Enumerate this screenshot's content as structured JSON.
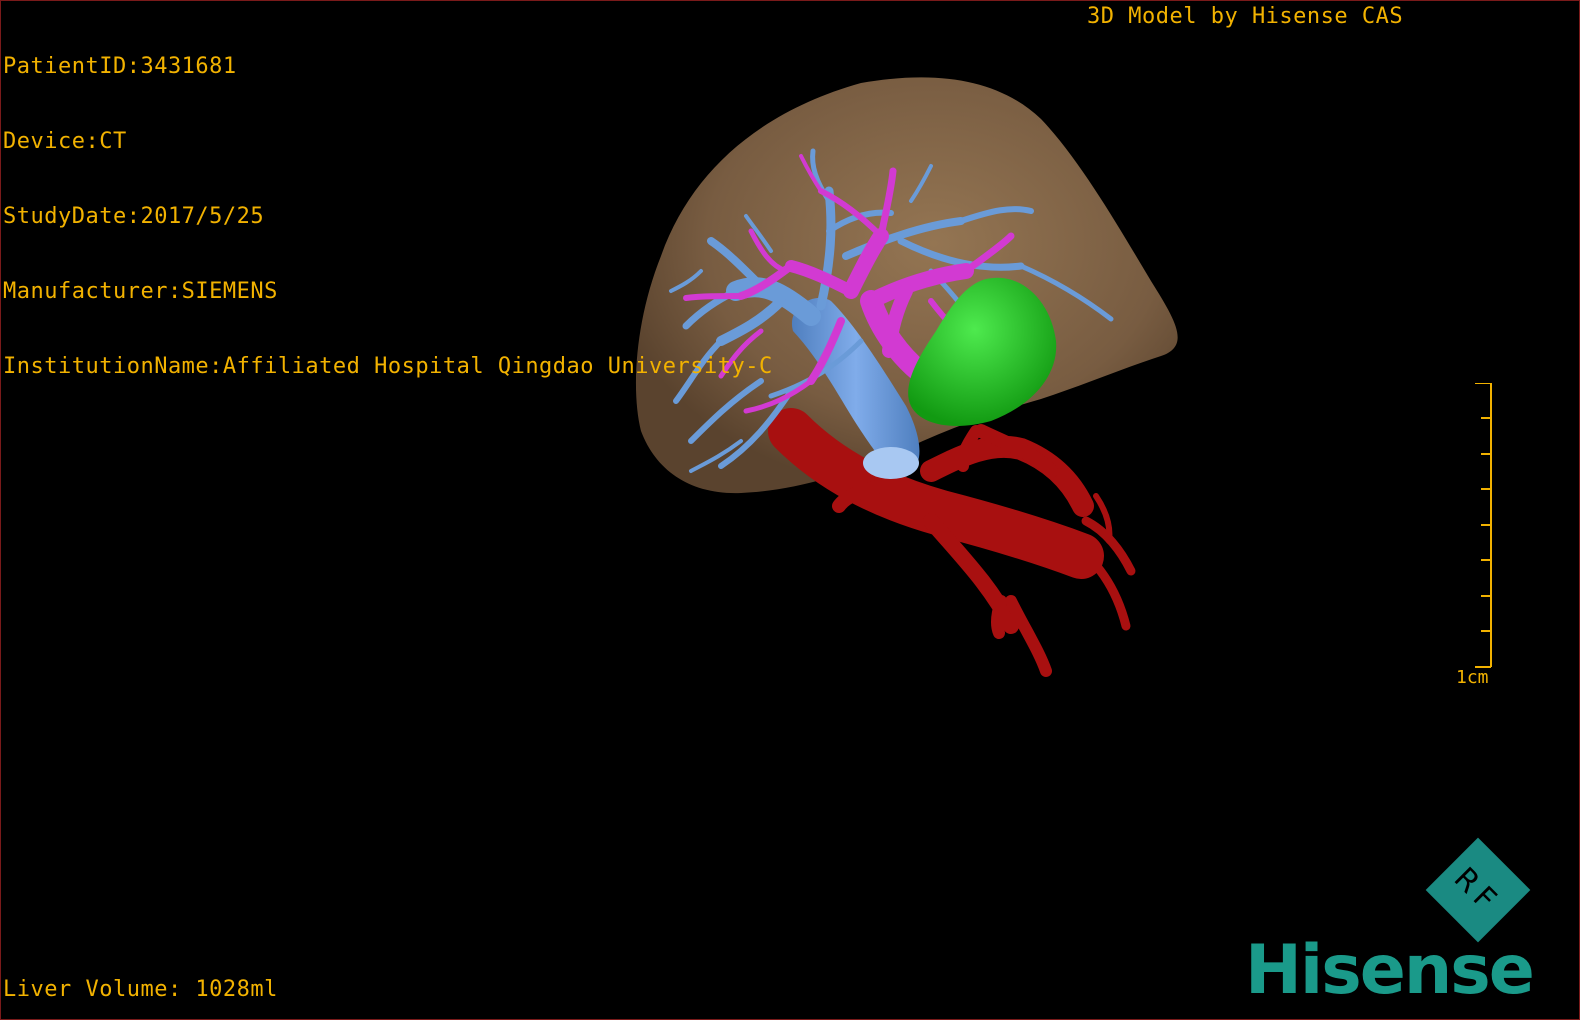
{
  "dicom_info": {
    "patient_id": "PatientID:3431681",
    "device": "Device:CT",
    "study_date": "StudyDate:2017/5/25",
    "manufacturer": "Manufacturer:SIEMENS",
    "institution": "InstitutionName:Affiliated Hospital Qingdao University-C"
  },
  "model_credit": "3D Model by Hisense CAS",
  "liver_volume": "Liver Volume: 1028ml",
  "scale": {
    "label": "1cm"
  },
  "badge": {
    "text": "RF"
  },
  "brand": {
    "name": "Hisense",
    "color": "#1a9a8a"
  },
  "colors": {
    "background": "#000000",
    "overlay_text": "#f2b200",
    "liver": "#8a6a48",
    "hepatic_vein": "#6a9bd8",
    "portal_vein": "#d23ad2",
    "gallbladder": "#22c822",
    "artery": "#a81010",
    "badge": "#1a8a82"
  }
}
